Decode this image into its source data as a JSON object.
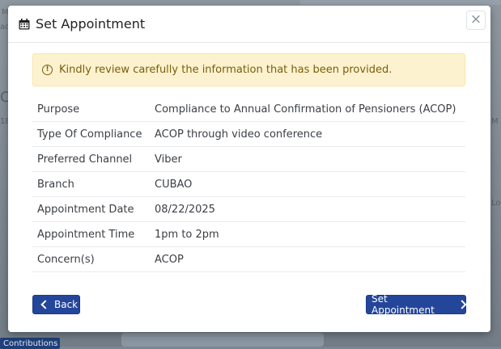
{
  "background": {
    "snippets": [
      "M",
      "ac",
      "C",
      "18",
      "M",
      "Lo"
    ],
    "contributions_button": "Contributions"
  },
  "modal": {
    "title": "Set Appointment",
    "close_label": "×",
    "alert_text": "Kindly review carefully the information that has been provided.",
    "rows": [
      {
        "label": "Purpose",
        "value": "Compliance to Annual Confirmation of Pensioners (ACOP)"
      },
      {
        "label": "Type Of Compliance",
        "value": "ACOP through video conference"
      },
      {
        "label": "Preferred Channel",
        "value": "Viber"
      },
      {
        "label": "Branch",
        "value": "CUBAO"
      },
      {
        "label": "Appointment Date",
        "value": "08/22/2025"
      },
      {
        "label": "Appointment Time",
        "value": "1pm to 2pm"
      },
      {
        "label": "Concern(s)",
        "value": "ACOP"
      }
    ],
    "back_label": "Back",
    "set_label": "Set Appointment"
  },
  "colors": {
    "primary_button": "#24469a",
    "alert_bg": "#fdf2cf",
    "alert_text": "#7a5d0d"
  }
}
